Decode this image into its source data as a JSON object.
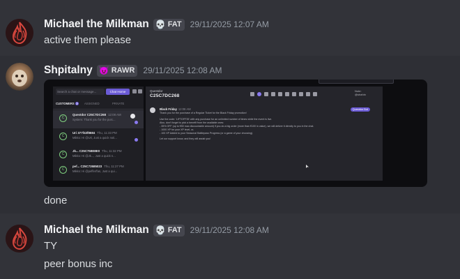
{
  "colors": {
    "bg": "#323339",
    "accent": "#6b5bd6",
    "timestamp": "#949ba4"
  },
  "messages": [
    {
      "username": "Michael the Milkman",
      "tag_emoji": "💀",
      "tag": "FAT",
      "timestamp": "29/11/2025 12:07 AM",
      "text": "active them please"
    },
    {
      "username": "Shpitalny",
      "tag_emoji": "😈",
      "tag": "RAWR",
      "timestamp": "29/11/2025 12:08 AM",
      "text": "done"
    },
    {
      "username": "Michael the Milkman",
      "tag_emoji": "💀",
      "tag": "FAT",
      "timestamp": "29/11/2025 12:08 AM",
      "text": "TY",
      "text2": "peer bonus inc"
    }
  ],
  "attachment": {
    "search_placeholder": "Search a chat or message...",
    "new_button": "Chat Home",
    "tabs": [
      "CUSTOMERS",
      "ASSIGNED",
      "PRIVATE"
    ],
    "customers_count": "3",
    "chats": [
      {
        "name": "Questdor C25C7DC268",
        "time": "12:08 AM",
        "preview": "System: Thank you for the purc..."
      },
      {
        "name": "Uri 377f43f8684",
        "time": "Thu, 11:33 PM",
        "preview": "Mikko: Hi @Uri, Just a quick noti..."
      },
      {
        "name": "Jk... C25C758E8E0",
        "time": "Thu, 11:32 PM",
        "preview": "Mikko: Hi @Jk..., Just a quick n..."
      },
      {
        "name": "pef... C25C73585023",
        "time": "Thu, 11:27 PM",
        "preview": "Mikko: Hi @peffer/fan, Just a qui..."
      },
      {
        "name": "Ana... C3359D854A4",
        "time": "Thu, 11:27 PM",
        "preview": "Mikko: Hi, Just a quick notificatio..."
      }
    ],
    "channel_name": "Questdor",
    "channel_id": "C25C7DC268",
    "note_label": "Note:",
    "note_value": "@shahin",
    "message_author": "Black Friday",
    "message_time": "12:08 AM",
    "message_pill": "Questdor Bot",
    "message_lines": [
      "Thank you for the purchase of a Regular Ticket for the Black Friday promotion!",
      "Use the code: 'LIFTOFF35' with any purchase for an unlimited number of times while the event is live.",
      "Also, don't forget to pick a benefit from the available ones:",
      "- 35% OFF (up to €50 max discountable amount) if you do a big order (more than €100 in value), we will deliver it directly to you in the chat.",
      "- 1000 XP for your XP level, or,",
      "- 100 XP Added to your Seasonal Battlepass Progress (or a game of your choosing).",
      "Let our support know, and they will assist you!"
    ]
  }
}
